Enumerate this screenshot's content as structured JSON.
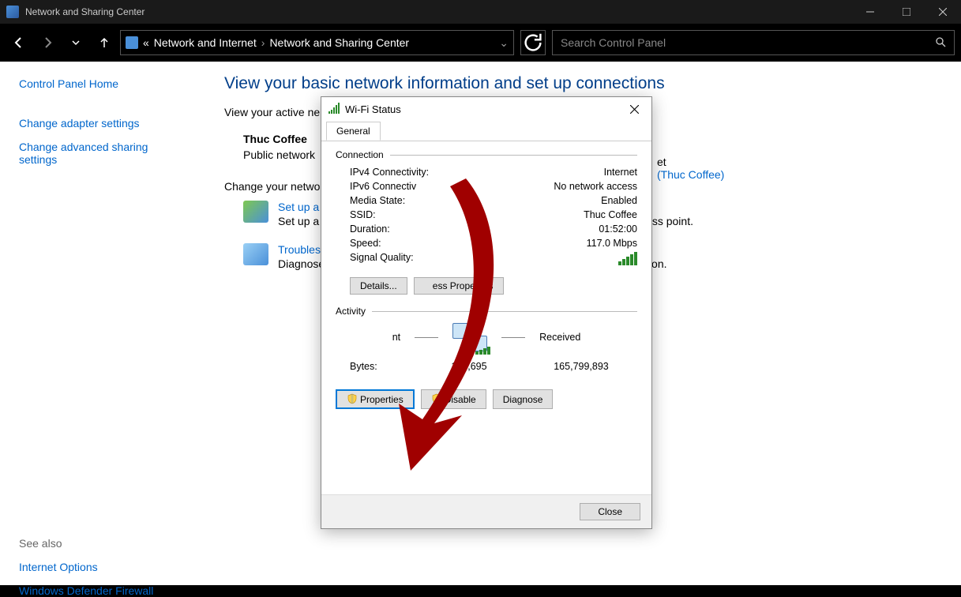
{
  "titlebar": {
    "title": "Network and Sharing Center"
  },
  "toolbar": {
    "crumb1": "Network and Internet",
    "crumb2": "Network and Sharing Center",
    "search_placeholder": "Search Control Panel",
    "pre": "«"
  },
  "sidebar": {
    "home": "Control Panel Home",
    "adapter": "Change adapter settings",
    "advanced": "Change advanced sharing settings",
    "seealso": "See also",
    "inet": "Internet Options",
    "firewall": "Windows Defender Firewall"
  },
  "main": {
    "heading": "View your basic network information and set up connections",
    "subhead": "View your active ne",
    "net_name": "Thuc Coffee",
    "net_type": "Public network",
    "changehead": "Change your netwo",
    "extra_et": "et",
    "extra_link": "(Thuc Coffee)",
    "task1_link": "Set up a",
    "task1_desc": "Set up a",
    "task1_tail": "ess point.",
    "task2_link": "Troubles",
    "task2_desc": "Diagnose",
    "task2_tail": "on."
  },
  "dialog": {
    "title": "Wi-Fi Status",
    "tab": "General",
    "group_connection": "Connection",
    "rows": {
      "ipv4_k": "IPv4 Connectivity:",
      "ipv4_v": "Internet",
      "ipv6_k": "IPv6 Connectiv",
      "ipv6_v": "No network access",
      "media_k": "Media State:",
      "media_v": "Enabled",
      "ssid_k": "SSID:",
      "ssid_v": "Thuc Coffee",
      "dur_k": "Duration:",
      "dur_v": "01:52:00",
      "speed_k": "Speed:",
      "speed_v": "117.0 Mbps",
      "sig_k": "Signal Quality:"
    },
    "details_btn": "Details...",
    "wireless_btn": "ess Properties",
    "group_activity": "Activity",
    "sent": "nt",
    "received": "Received",
    "bytes_label": "Bytes:",
    "bytes_sent": "173,695",
    "bytes_recv": "165,799,893",
    "properties_btn": "Properties",
    "disable_btn": "Disable",
    "diagnose_btn": "Diagnose",
    "close_btn": "Close"
  }
}
